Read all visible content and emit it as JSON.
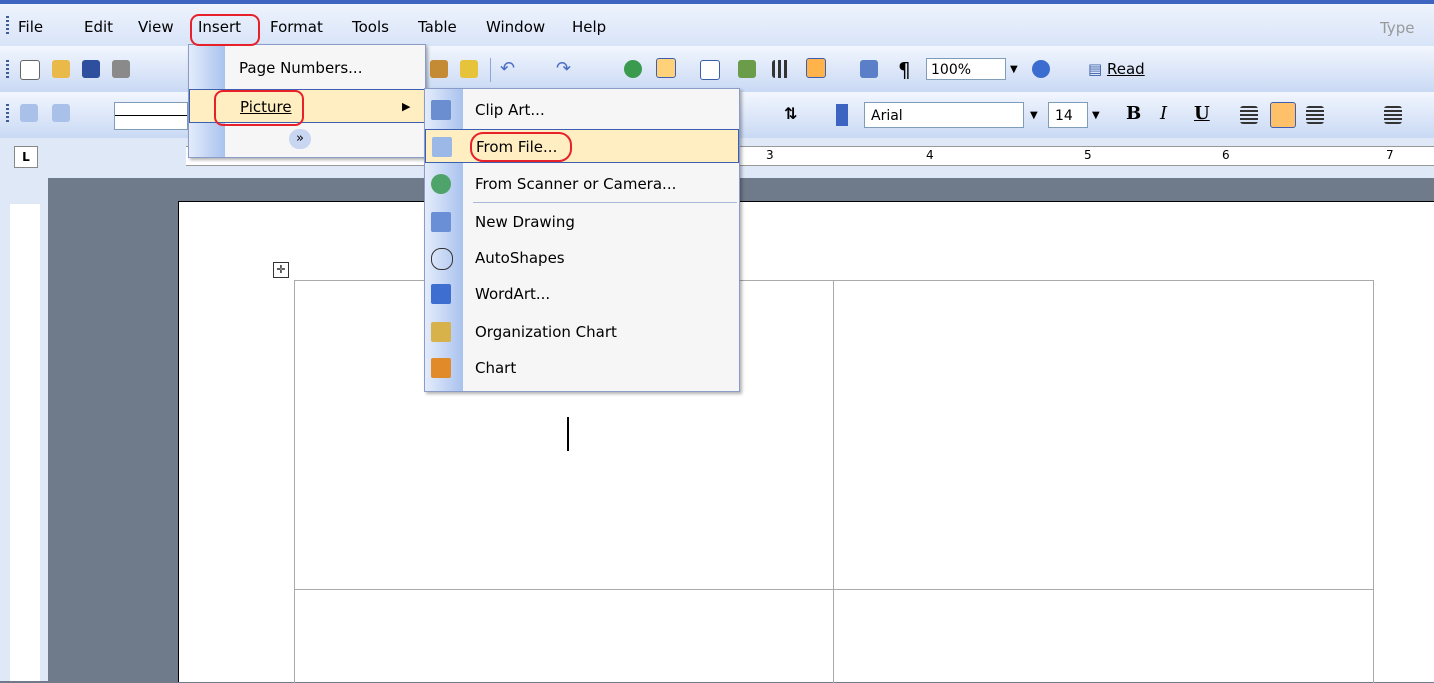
{
  "menubar": {
    "items": [
      "File",
      "Edit",
      "View",
      "Insert",
      "Format",
      "Tools",
      "Table",
      "Window",
      "Help"
    ],
    "type_hint": "Type"
  },
  "toolbar": {
    "zoom": "100%",
    "read": "Read",
    "font": "Arial",
    "size": "14",
    "bold": "B",
    "italic": "I",
    "underline": "U",
    "pilcrow": "¶"
  },
  "ruler": {
    "marks": [
      "3",
      "4",
      "5",
      "6",
      "7"
    ],
    "tab_glyph": "L"
  },
  "insert_menu": {
    "items": [
      "Page Numbers...",
      "Picture"
    ],
    "expand": "»"
  },
  "picture_submenu": {
    "items": [
      {
        "label": "Clip Art...",
        "icon": "clip-art-icon"
      },
      {
        "label": "From File...",
        "icon": "from-file-icon"
      },
      {
        "label": "From Scanner or Camera...",
        "icon": "scanner-icon"
      },
      {
        "label": "New Drawing",
        "icon": "new-drawing-icon"
      },
      {
        "label": "AutoShapes",
        "icon": "autoshapes-icon"
      },
      {
        "label": "WordArt...",
        "icon": "wordart-icon"
      },
      {
        "label": "Organization Chart",
        "icon": "org-chart-icon"
      },
      {
        "label": "Chart",
        "icon": "chart-icon"
      }
    ]
  },
  "colors": {
    "accent": "#3d64c0",
    "highlight": "#ffeec2",
    "annotation": "#e8202a"
  }
}
